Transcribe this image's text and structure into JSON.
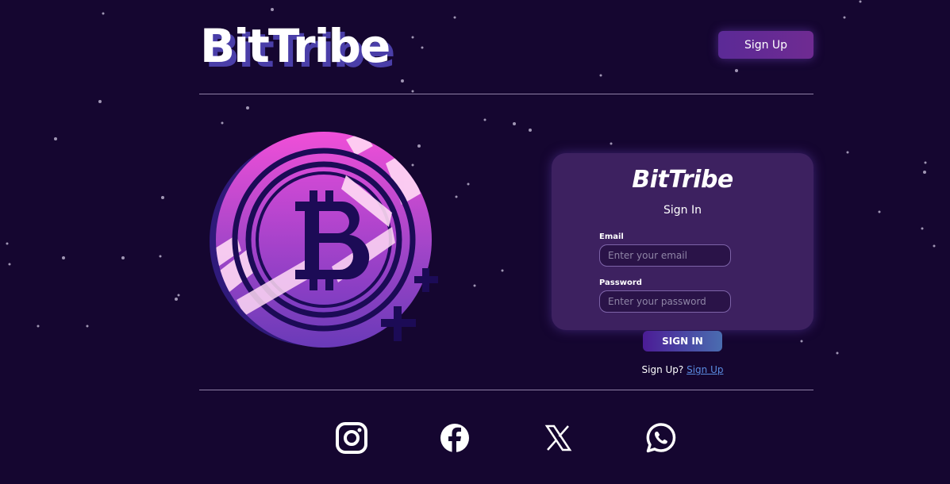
{
  "header": {
    "brand": "BitTribe",
    "signup_button": "Sign Up"
  },
  "login": {
    "brand": "BitTribe",
    "subtitle": "Sign In",
    "email_label": "Email",
    "email_placeholder": "Enter your email",
    "password_label": "Password",
    "password_placeholder": "Enter your password",
    "submit_label": "SIGN IN",
    "signup_prompt": "Sign Up?",
    "signup_link": "Sign Up"
  },
  "social": [
    {
      "icon": "instagram-icon"
    },
    {
      "icon": "facebook-icon"
    },
    {
      "icon": "x-icon"
    },
    {
      "icon": "whatsapp-icon"
    }
  ],
  "colors": {
    "background": "#150630",
    "card": "#3d2160",
    "accent": "#5b2a96",
    "link": "#5a8be0"
  }
}
